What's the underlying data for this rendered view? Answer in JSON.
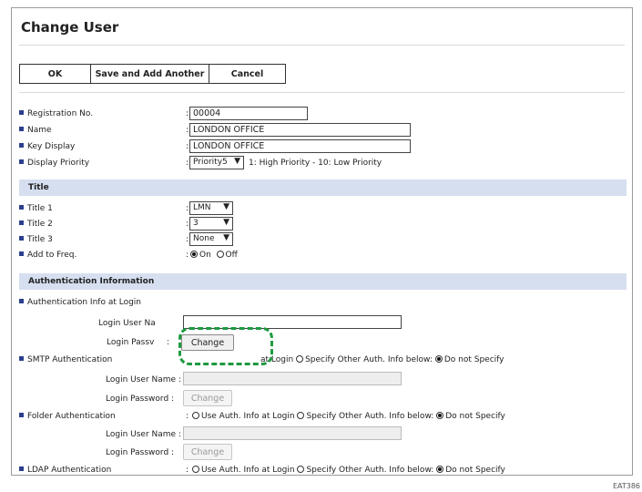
{
  "page_title": "Change User",
  "toolbar": {
    "ok": "OK",
    "save_add": "Save and Add Another",
    "cancel": "Cancel"
  },
  "fields": {
    "registration_label": "Registration No.",
    "registration_value": "00004",
    "name_label": "Name",
    "name_value": "LONDON OFFICE",
    "key_display_label": "Key Display",
    "key_display_value": "LONDON OFFICE",
    "display_priority_label": "Display Priority",
    "display_priority_value": "Priority5",
    "display_priority_hint": "1: High Priority - 10: Low Priority"
  },
  "title_section": {
    "heading": "Title",
    "title1_label": "Title 1",
    "title1_value": "LMN",
    "title2_label": "Title 2",
    "title2_value": "3",
    "title3_label": "Title 3",
    "title3_value": "None",
    "freq_label": "Add to Freq.",
    "on": "On",
    "off": "Off"
  },
  "auth_section": {
    "heading": "Authentication Information",
    "auth_login_label": "Authentication Info at Login",
    "login_user_name_cut": "Login User Na",
    "login_password_cut": "Login Passv",
    "login_user_name": "Login User Name :",
    "login_password": "Login Password :",
    "change": "Change",
    "smtp_label": "SMTP Authentication",
    "smtp_use_cut": "at Login",
    "folder_label": "Folder Authentication",
    "ldap_label": "LDAP Authentication",
    "use_auth": "Use Auth. Info at Login",
    "specify_other": "Specify Other Auth. Info below:",
    "do_not_specify": "Do not Specify"
  },
  "figure_tag": "EAT386"
}
